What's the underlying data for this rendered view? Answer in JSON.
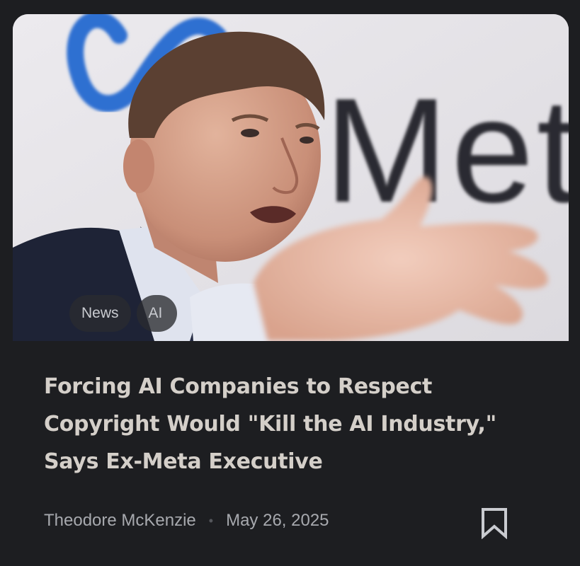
{
  "article": {
    "image": {
      "logo_text": "Meta",
      "description_icon": "portrait-photo"
    },
    "tags": [
      "News",
      "AI"
    ],
    "title": "Forcing AI Companies to Respect Copyright Would \"Kill the AI Industry,\" Says Ex-Meta Executive",
    "author": "Theodore McKenzie",
    "separator": "•",
    "date": "May 26, 2025",
    "bookmark_icon": "bookmark-icon"
  },
  "colors": {
    "background": "#1d1e21",
    "title": "#d4cfc9",
    "meta_text": "#a7a9ae",
    "tag_background": "#2a2c30",
    "meta_logo_blue": "#2f6fd1"
  }
}
